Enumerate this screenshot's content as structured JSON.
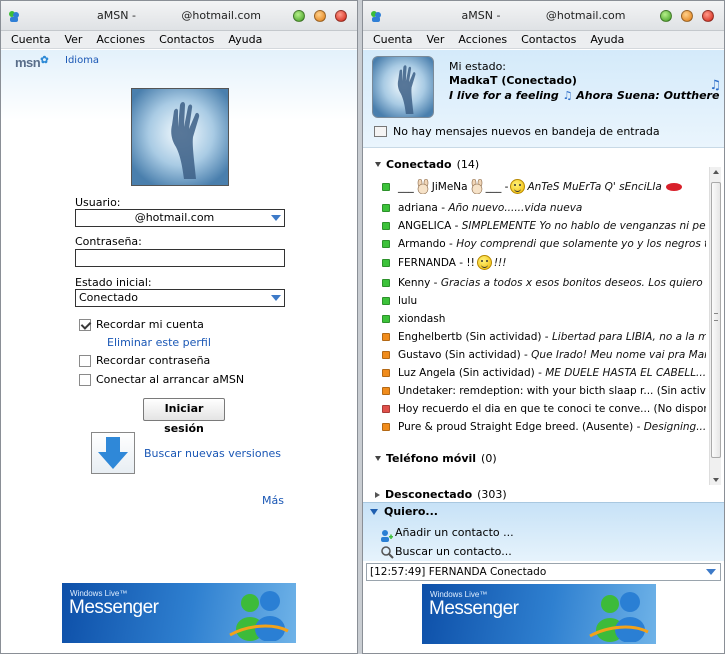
{
  "colors": {
    "link": "#1a57b5",
    "online": "#3cc23a",
    "idle": "#f08c1c",
    "busy": "#e0504a",
    "accent": "#3d7ac8"
  },
  "left_window": {
    "title": "aMSN -             @hotmail.com",
    "menu": [
      "Cuenta",
      "Ver",
      "Acciones",
      "Contactos",
      "Ayuda"
    ],
    "logo": "msn",
    "language_link": "Idioma",
    "user_label": "Usuario:",
    "user_value": "@hotmail.com",
    "password_label": "Contraseña:",
    "password_value": "",
    "initial_state_label": "Estado inicial:",
    "initial_state_value": "Conectado",
    "remember_account": {
      "label": "Recordar mi cuenta",
      "checked": true
    },
    "delete_profile_link": "Eliminar este perfil",
    "remember_password": {
      "label": "Recordar contraseña",
      "checked": false
    },
    "connect_on_start": {
      "label": "Conectar al arrancar aMSN",
      "checked": false
    },
    "login_button": "Iniciar sesión",
    "updates_link": "Buscar nuevas versiones",
    "more_link": "Más",
    "banner": {
      "small": "Windows Live™",
      "big": "Messenger"
    }
  },
  "right_window": {
    "title": "aMSN -             @hotmail.com",
    "menu": [
      "Cuenta",
      "Ver",
      "Acciones",
      "Contactos",
      "Ayuda"
    ],
    "my_state_label": "Mi estado:",
    "nick": "MadkaT (Conectado)",
    "psm_left": "I live for a feeling",
    "psm_right": "Ahora Suena: Outthere",
    "mail_status": "No hay mensajes nuevos en bandeja de entrada",
    "groups": {
      "online": {
        "name": "Conectado",
        "count": "(14)"
      },
      "mobile": {
        "name": "Teléfono móvil",
        "count": "(0)"
      },
      "offline": {
        "name": "Desconectado",
        "count": "(303)"
      }
    },
    "contacts": [
      {
        "status": "online",
        "name": "___",
        "name2": "JiMeNa",
        "name3": "___ -",
        "psm": "AnTeS MuErTa Q' sEnciLla"
      },
      {
        "status": "online",
        "name": "adriana -",
        "psm": "Año nuevo......vida nueva"
      },
      {
        "status": "online",
        "name": "ANGELICA -",
        "psm": "SIMPLEMENTE Yo no hablo de venganzas ni perdones"
      },
      {
        "status": "online",
        "name": "Armando -",
        "psm": "Hoy comprendi que solamente yo y los negros tra"
      },
      {
        "status": "online",
        "name": "FERNANDA - !!",
        "psm": "!!!"
      },
      {
        "status": "online",
        "name": "Kenny -",
        "psm": "Gracias a todos x esos bonitos deseos. Los quiero"
      },
      {
        "status": "online",
        "name": "lulu",
        "psm": ""
      },
      {
        "status": "online",
        "name": "xiondash",
        "psm": ""
      },
      {
        "status": "idle",
        "name": "Enghelbertb (Sin actividad) -",
        "psm": "Libertad para LIBIA, no a la mue"
      },
      {
        "status": "idle",
        "name": "Gustavo (Sin actividad) -",
        "psm": "Que Irado! Meu nome vai pra Marte"
      },
      {
        "status": "idle",
        "name": "Luz Angela (Sin actividad) -",
        "psm": "ME DUELE HASTA EL CABELL..."
      },
      {
        "status": "idle",
        "name": "Undetaker: remdeption: with your bicth slaap r... (Sin actividad)",
        "psm": ""
      },
      {
        "status": "busy",
        "name": "Hoy recuerdo el dia en que te conoci te conve... (No disponible)",
        "psm": ""
      },
      {
        "status": "idle",
        "name": "Pure & proud Straight Edge breed. (Ausente) -",
        "psm": "Designing... w"
      }
    ],
    "quiero": {
      "title": "Quiero...",
      "add_contact": "Añadir un contacto ...",
      "search_contact": "Buscar un contacto..."
    },
    "event_log": "[12:57:49] FERNANDA Conectado",
    "banner": {
      "small": "Windows Live™",
      "big": "Messenger"
    }
  }
}
